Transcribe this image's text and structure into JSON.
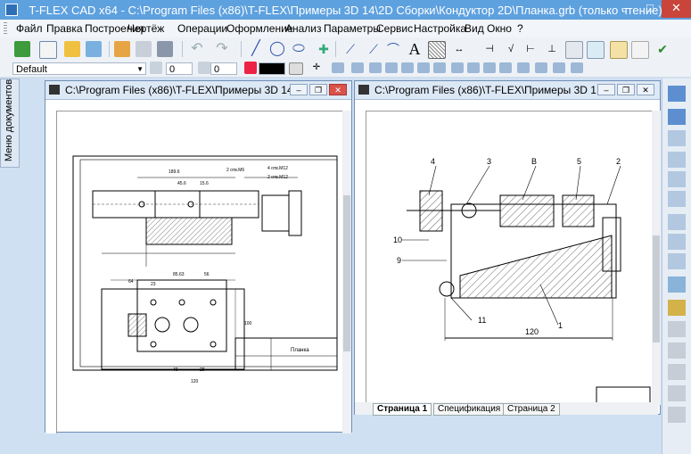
{
  "window": {
    "title": "T-FLEX CAD x64 - C:\\Program Files (x86)\\T-FLEX\\Примеры 3D 14\\2D Сборки\\Кондуктор 2D\\Планка.grb (только чтение)",
    "min": "–",
    "max": "□",
    "close": "✕"
  },
  "menu": [
    "Файл",
    "Правка",
    "Построения",
    "Чертёж",
    "Операции",
    "Оформление",
    "Анализ",
    "Параметры",
    "Сервис",
    "Настройка",
    "Вид",
    "Окно",
    "?"
  ],
  "toolbar2": {
    "style": "Default",
    "layer_value": "0",
    "level_value": "0"
  },
  "sidebar": {
    "tab_label": "Меню документов"
  },
  "doc_left": {
    "title": "C:\\Program Files (x86)\\T-FLEX\\Примеры 3D 14\\...",
    "stamp_label": "Планка",
    "dims": [
      "189.6",
      "45.6",
      "15.6",
      "2 отв.М6",
      "4 отв.М12",
      "2 отв.М12",
      "85.63",
      "56",
      "23",
      "120",
      "64",
      "40",
      "28",
      "100"
    ]
  },
  "doc_right": {
    "title": "C:\\Program Files (x86)\\T-FLEX\\Примеры 3D 1...",
    "callouts": [
      "4",
      "3",
      "В",
      "5",
      "2",
      "10",
      "9",
      "11",
      "1"
    ],
    "dimension": "120"
  },
  "page_tabs": [
    "Страница 1",
    "Спецификация",
    "Страница 2"
  ],
  "colors": {
    "accent": "#5ea1df",
    "close": "#c9443a"
  }
}
